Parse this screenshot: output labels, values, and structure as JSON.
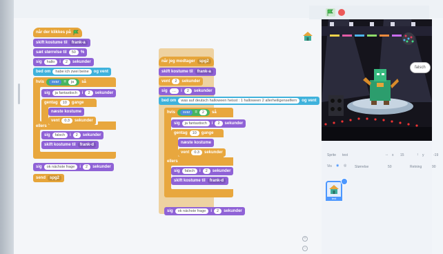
{
  "script_left": {
    "hat": {
      "text": "når der klikkes på"
    },
    "switch_costume": {
      "text": "skift kostume til",
      "value": "frank-a"
    },
    "set_volume": {
      "text": "sæt størrelse til",
      "value": "50",
      "unit": "%"
    },
    "say_hello": {
      "text": "sig",
      "value": "hallo",
      "mid": "i",
      "secs": "2",
      "unit": "sekunder"
    },
    "ask": {
      "text": "bed om",
      "value": "habe ich zwei beine",
      "tail": "og vent"
    },
    "if_cond": {
      "text": "hvis",
      "left": "svar",
      "op": "=",
      "right": "ja",
      "tail": "så"
    },
    "say_fant": {
      "text": "sig",
      "value": "ja fantastisch",
      "mid": "i",
      "secs": "2",
      "unit": "sekunder"
    },
    "repeat": {
      "text": "gentag",
      "value": "10",
      "unit": "gange"
    },
    "next_costume": {
      "text": "næste kostume"
    },
    "wait": {
      "text": "vent",
      "value": "0.3",
      "unit": "sekunder"
    },
    "else": {
      "text": "ellers"
    },
    "say_falsch": {
      "text": "sig",
      "value": "falsch",
      "mid": "i",
      "secs": "2",
      "unit": "sekunder"
    },
    "switch_d": {
      "text": "skift kostume til",
      "value": "frank-d"
    },
    "say_next": {
      "text": "sig",
      "value": "ok nächste frage",
      "mid": "i",
      "secs": "2",
      "unit": "sekunder"
    },
    "send": {
      "text": "send",
      "value": "spg2"
    }
  },
  "script_mid": {
    "hat": {
      "text": "når jeg modtager",
      "value": "spg2"
    },
    "switch_costume": {
      "text": "skift kostume til",
      "value": "frank-a"
    },
    "wait": {
      "text": "vent",
      "value": "2",
      "unit": "sekunder"
    },
    "say": {
      "text": "sig",
      "value": "…",
      "mid": "i",
      "secs": "2",
      "unit": "sekunder"
    },
    "ask": {
      "text": "bed om",
      "value": "was auf deutsch halloween heisst : 1 halloween 2 allerheiligenselfern",
      "tail": "og vent"
    },
    "if_cond": {
      "text": "hvis",
      "left": "svar",
      "op": "=",
      "right": "2",
      "tail": "så"
    },
    "say_fant": {
      "text": "sig",
      "value": "ja fantastisch",
      "mid": "i",
      "secs": "2",
      "unit": "sekunder"
    },
    "repeat": {
      "text": "gentag",
      "value": "10",
      "unit": "gange"
    },
    "next_costume": {
      "text": "næste kostume"
    },
    "wait2": {
      "text": "vent",
      "value": "0.3",
      "unit": "sekunder"
    },
    "else": {
      "text": "ellers"
    },
    "say_falsch": {
      "text": "sig",
      "value": "falsch",
      "mid": "i",
      "secs": "2",
      "unit": "sekunder"
    },
    "switch_d": {
      "text": "skift kostume til",
      "value": "frank-d"
    },
    "say_next": {
      "text": "sig",
      "value": "ok nächste frage",
      "mid": "i",
      "secs": "2",
      "unit": "sekunder"
    }
  },
  "stage": {
    "speech": "falsch"
  },
  "sprite_info": {
    "sprite_label": "Sprite",
    "sprite_name": "test",
    "x_label": "x",
    "x_value": "15",
    "y_label": "y",
    "y_value": "-19",
    "show_label": "Vis",
    "size_label": "Størrelse",
    "size_value": "50",
    "direction_label": "Retning",
    "direction_value": "90"
  },
  "sprite_tile": {
    "name": "test"
  },
  "icons": [
    "green-flag-icon",
    "stop-icon",
    "sprite-house-icon",
    "eye-icon",
    "zoom-icon"
  ],
  "colors": {
    "looks": "#8f62d6",
    "sensing": "#3fb2dc",
    "control": "#e8a73e",
    "operators": "#47b55f",
    "events": "#e6a53a",
    "accent": "#4c97ff"
  }
}
